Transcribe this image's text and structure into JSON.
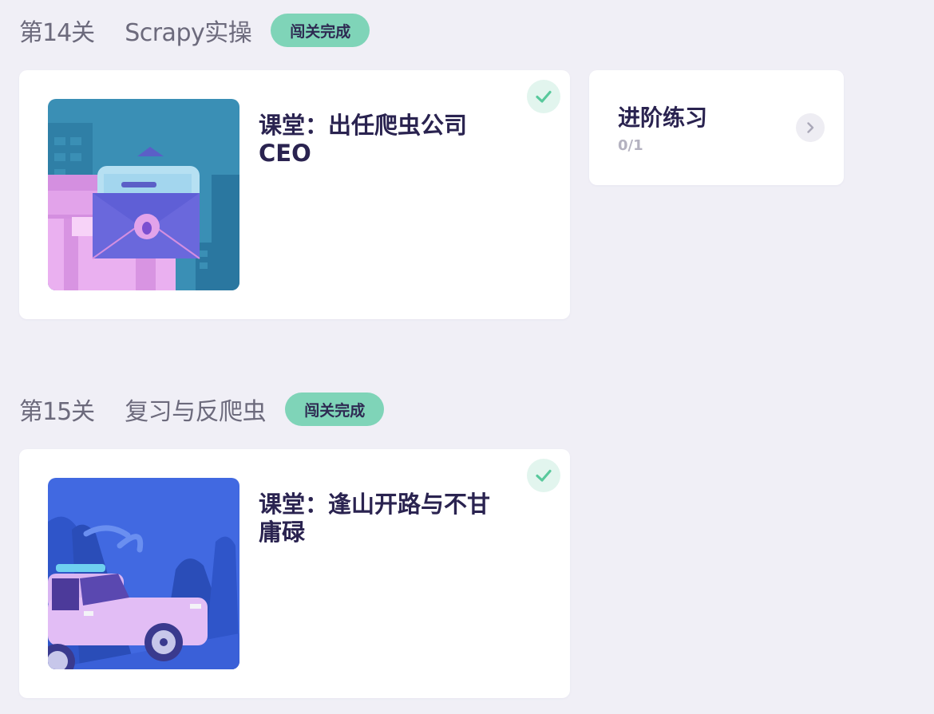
{
  "levels": [
    {
      "number": "第14关",
      "name": "Scrapy实操",
      "status": "闯关完成",
      "lesson": {
        "title": "课堂：出任爬虫公司CEO",
        "completed": true,
        "image": "envelope-bug-illustration"
      },
      "practice": {
        "title": "进阶练习",
        "progress": "0/1"
      }
    },
    {
      "number": "第15关",
      "name": "复习与反爬虫",
      "status": "闯关完成",
      "lesson": {
        "title": "课堂：逢山开路与不甘庸碌",
        "completed": true,
        "image": "car-mountains-illustration"
      }
    }
  ],
  "colors": {
    "background": "#f0eff6",
    "badge": "#7fd4b8",
    "check": "#58c99c",
    "title": "#2a2350"
  }
}
